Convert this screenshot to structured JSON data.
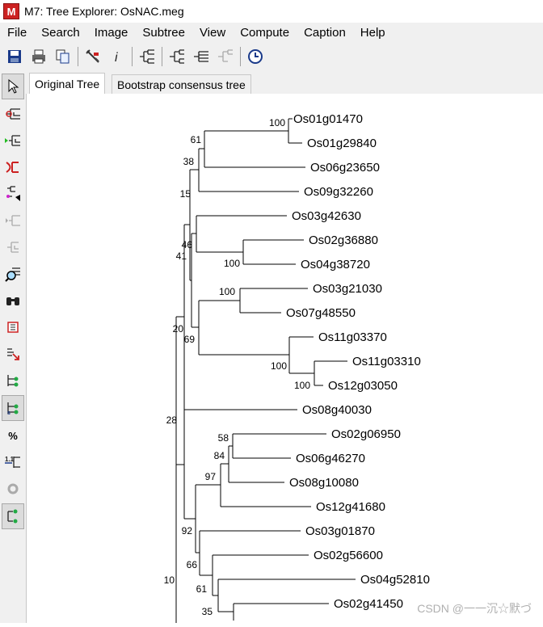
{
  "window": {
    "title": "M7: Tree Explorer: OsNAC.meg",
    "app_icon_letter": "M"
  },
  "menu": [
    "File",
    "Search",
    "Image",
    "Subtree",
    "View",
    "Compute",
    "Caption",
    "Help"
  ],
  "tabs": {
    "active": "Original Tree",
    "inactive": "Bootstrap consensus tree"
  },
  "sidebar": {
    "percent_label": "%",
    "scale_label": "1.1"
  },
  "tree": {
    "taxa": [
      "Os01g01470",
      "Os01g29840",
      "Os06g23650",
      "Os09g32260",
      "Os03g42630",
      "Os02g36880",
      "Os04g38720",
      "Os03g21030",
      "Os07g48550",
      "Os11g03370",
      "Os11g03310",
      "Os12g03050",
      "Os08g40030",
      "Os02g06950",
      "Os06g46270",
      "Os08g10080",
      "Os12g41680",
      "Os03g01870",
      "Os02g56600",
      "Os04g52810",
      "Os02g41450"
    ],
    "bootstrap": [
      "100",
      "61",
      "38",
      "15",
      "46",
      "41",
      "100",
      "100",
      "20",
      "69",
      "100",
      "100",
      "28",
      "58",
      "84",
      "97",
      "92",
      "66",
      "61",
      "35",
      "10"
    ]
  },
  "watermark": "CSDN @一一沉☆默づ"
}
